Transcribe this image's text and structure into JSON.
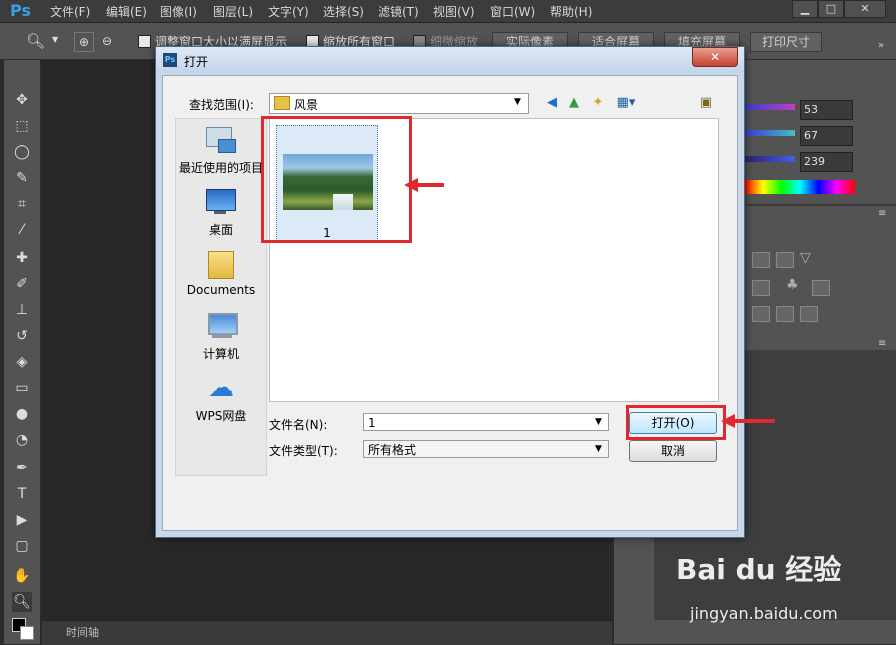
{
  "menubar": {
    "logo": "Ps",
    "items": [
      "文件(F)",
      "编辑(E)",
      "图像(I)",
      "图层(L)",
      "文字(Y)",
      "选择(S)",
      "滤镜(T)",
      "视图(V)",
      "窗口(W)",
      "帮助(H)"
    ]
  },
  "optionsbar": {
    "resize_windows": "调整窗口大小以满屏显示",
    "zoom_all": "缩放所有窗口",
    "scrubby_zoom": "细微缩放",
    "actual_pixels": "实际像素",
    "fit_screen": "适合屏幕",
    "fill_screen": "填充屏幕",
    "print_size": "打印尺寸"
  },
  "color_panel": {
    "r": "53",
    "g": "67",
    "b": "239"
  },
  "timeline": {
    "label": "时间轴"
  },
  "dialog": {
    "title": "打开",
    "close": "✕",
    "look_in_label": "查找范围(I):",
    "look_in_value": "风景",
    "places": [
      {
        "label": "最近使用的项目"
      },
      {
        "label": "桌面"
      },
      {
        "label": "Documents"
      },
      {
        "label": "计算机"
      },
      {
        "label": "WPS网盘"
      }
    ],
    "file": {
      "name": "1"
    },
    "filename_label": "文件名(N):",
    "filename_value": "1",
    "filetype_label": "文件类型(T):",
    "filetype_value": "所有格式",
    "open_button": "打开(O)",
    "cancel_button": "取消"
  },
  "watermark": {
    "brand": "Bai du 经验",
    "url": "jingyan.baidu.com"
  }
}
